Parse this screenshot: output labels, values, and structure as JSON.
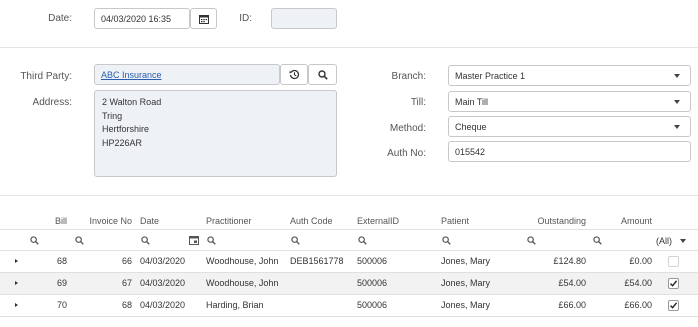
{
  "header": {
    "date_label": "Date:",
    "date_value": "04/03/2020 16:35",
    "id_label": "ID:",
    "id_value": ""
  },
  "details": {
    "third_party_label": "Third Party:",
    "third_party_value": "ABC Insurance",
    "address_label": "Address:",
    "address_lines": [
      "2 Walton Road",
      "Tring",
      "Hertforshire",
      "HP226AR"
    ],
    "branch_label": "Branch:",
    "branch_value": "Master Practice 1",
    "till_label": "Till:",
    "till_value": "Main Till",
    "method_label": "Method:",
    "method_value": "Cheque",
    "auth_no_label": "Auth No:",
    "auth_no_value": "015542"
  },
  "grid": {
    "columns": [
      "Bill",
      "Invoice No",
      "Date",
      "Practitioner",
      "Auth Code",
      "ExternalID",
      "Patient",
      "Outstanding",
      "Amount"
    ],
    "all_filter": "(All)",
    "rows": [
      {
        "bill": "68",
        "invoice": "66",
        "date": "04/03/2020",
        "practitioner": "Woodhouse, John",
        "auth": "DEB1561778",
        "external": "500006",
        "patient": "Jones, Mary",
        "outstanding": "£124.80",
        "amount": "£0.00",
        "checked": false
      },
      {
        "bill": "69",
        "invoice": "67",
        "date": "04/03/2020",
        "practitioner": "Woodhouse, John",
        "auth": "",
        "external": "500006",
        "patient": "Jones, Mary",
        "outstanding": "£54.00",
        "amount": "£54.00",
        "checked": true
      },
      {
        "bill": "70",
        "invoice": "68",
        "date": "04/03/2020",
        "practitioner": "Harding, Brian",
        "auth": "",
        "external": "500006",
        "patient": "Jones, Mary",
        "outstanding": "£66.00",
        "amount": "£66.00",
        "checked": true
      }
    ]
  }
}
